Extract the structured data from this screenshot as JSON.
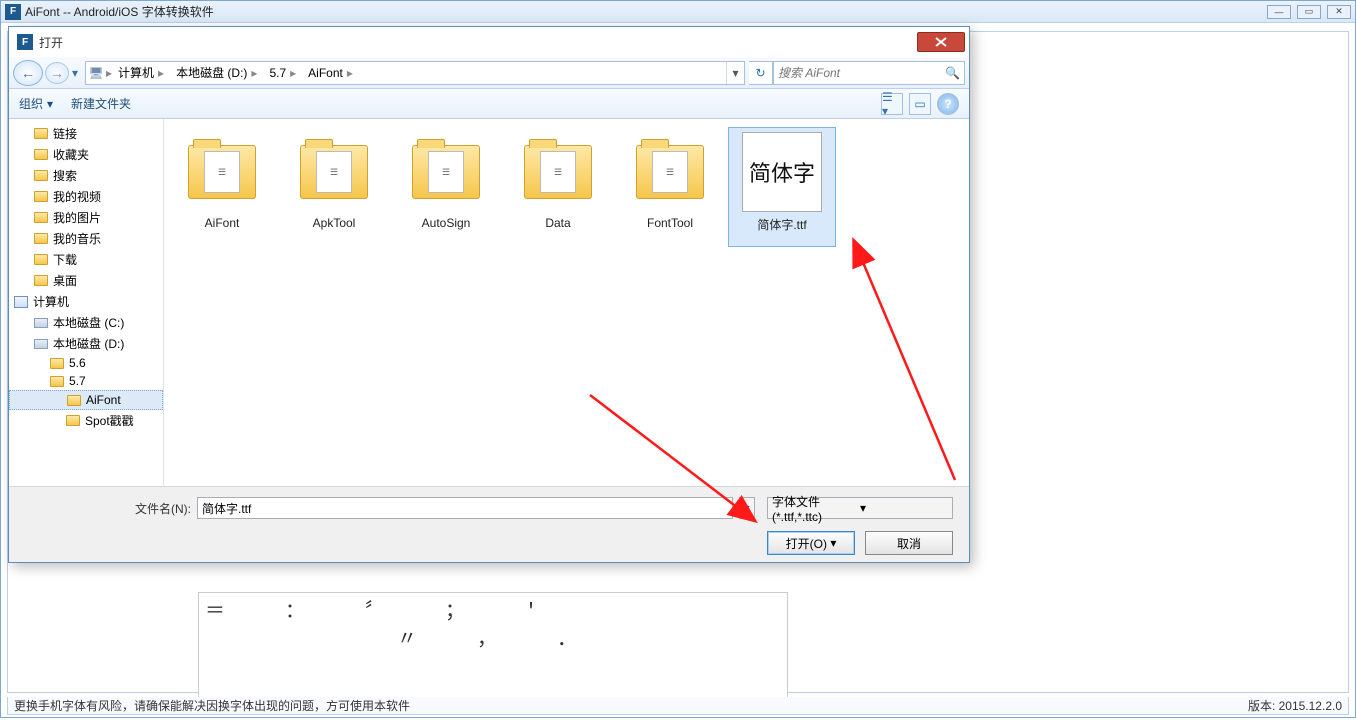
{
  "app": {
    "title": "AiFont -- Android/iOS 字体转换软件",
    "icon_letter": "F"
  },
  "status": {
    "warning": "更换手机字体有风险，请确保能解决因换字体出现的问题，方可使用本软件",
    "version_label": "版本: 2015.12.2.0"
  },
  "ascii": "＝  ：  〞  ；  '\n        〃  ，  ．",
  "dialog": {
    "title": "打开",
    "icon_letter": "F",
    "breadcrumb": [
      "计算机",
      "本地磁盘 (D:)",
      "5.7",
      "AiFont"
    ],
    "search_placeholder": "搜索 AiFont",
    "toolbar": {
      "organize": "组织",
      "newfolder": "新建文件夹"
    },
    "tree": [
      {
        "label": "链接",
        "icon": "folder",
        "indent": 1
      },
      {
        "label": "收藏夹",
        "icon": "folder",
        "indent": 1
      },
      {
        "label": "搜索",
        "icon": "folder",
        "indent": 1
      },
      {
        "label": "我的视频",
        "icon": "folder",
        "indent": 1
      },
      {
        "label": "我的图片",
        "icon": "folder",
        "indent": 1
      },
      {
        "label": "我的音乐",
        "icon": "folder",
        "indent": 1
      },
      {
        "label": "下载",
        "icon": "folder",
        "indent": 1
      },
      {
        "label": "桌面",
        "icon": "folder",
        "indent": 1
      },
      {
        "label": "计算机",
        "icon": "comp",
        "indent": 0
      },
      {
        "label": "本地磁盘 (C:)",
        "icon": "drive",
        "indent": 1
      },
      {
        "label": "本地磁盘 (D:)",
        "icon": "drive",
        "indent": 1
      },
      {
        "label": "5.6",
        "icon": "folder",
        "indent": 2
      },
      {
        "label": "5.7",
        "icon": "folder",
        "indent": 2
      },
      {
        "label": "AiFont",
        "icon": "folder",
        "indent": 3,
        "selected": true
      },
      {
        "label": "Spot戳戳",
        "icon": "folder",
        "indent": 3
      }
    ],
    "files": [
      {
        "name": "AiFont",
        "type": "folder"
      },
      {
        "name": "ApkTool",
        "type": "folder"
      },
      {
        "name": "AutoSign",
        "type": "folder"
      },
      {
        "name": "Data",
        "type": "folder"
      },
      {
        "name": "FontTool",
        "type": "folder"
      },
      {
        "name": "简体字.ttf",
        "type": "font",
        "preview": "简体字",
        "selected": true
      }
    ],
    "filename_label": "文件名(N):",
    "filename_value": "简体字.ttf",
    "filter": "字体文件(*.ttf,*.ttc)",
    "open_btn": "打开(O)",
    "cancel_btn": "取消"
  }
}
